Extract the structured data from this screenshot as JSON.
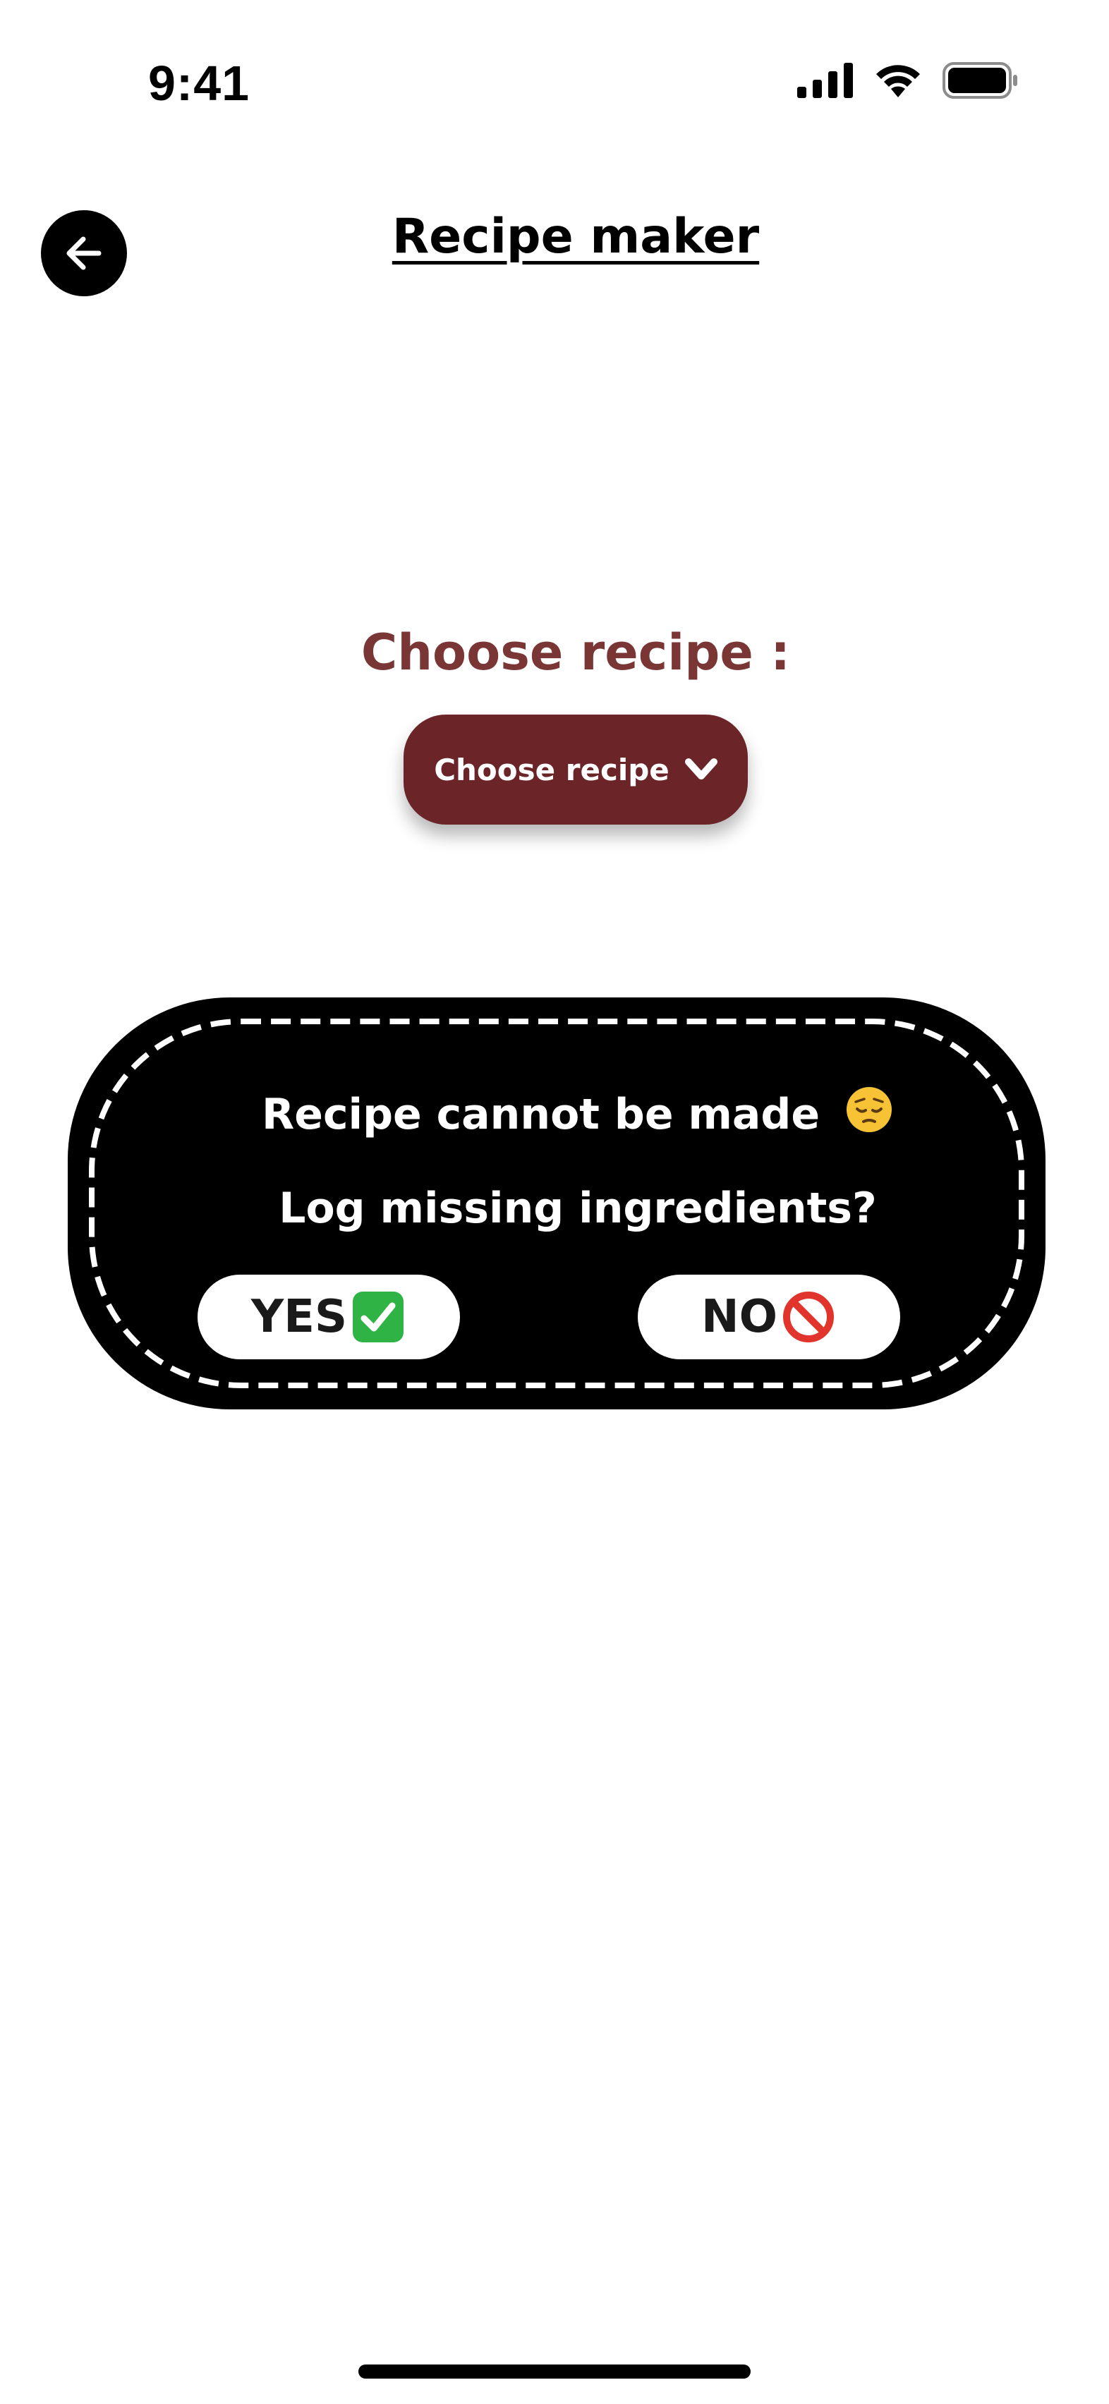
{
  "status_bar": {
    "time": "9:41"
  },
  "header": {
    "title": "Recipe maker",
    "back_icon": "arrow-left-icon"
  },
  "recipe_picker": {
    "label": "Choose recipe :",
    "dropdown_label": "Choose recipe",
    "dropdown_icon": "chevron-down-icon"
  },
  "dialog": {
    "message": "Recipe cannot be made",
    "message_emoji": "pensive-face-icon",
    "question": "Log missing ingredients?",
    "yes_label": "YES",
    "yes_icon": "check-mark-icon",
    "no_label": "NO",
    "no_icon": "prohibited-icon"
  },
  "colors": {
    "accent_text": "#7a3535",
    "dropdown_bg": "#6b2528",
    "check_green": "#2fb344",
    "prohibited_red": "#e0342c"
  }
}
